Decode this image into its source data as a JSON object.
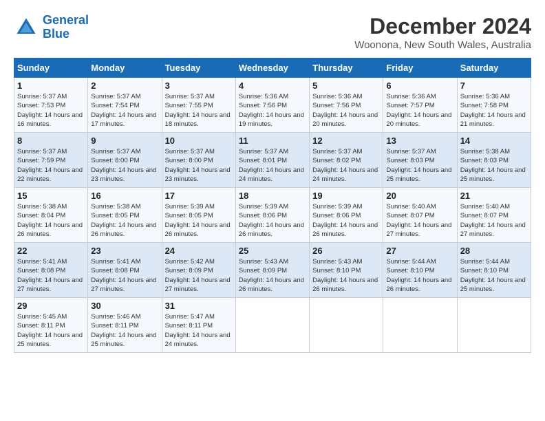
{
  "logo": {
    "line1": "General",
    "line2": "Blue"
  },
  "title": "December 2024",
  "subtitle": "Woonona, New South Wales, Australia",
  "weekdays": [
    "Sunday",
    "Monday",
    "Tuesday",
    "Wednesday",
    "Thursday",
    "Friday",
    "Saturday"
  ],
  "weeks": [
    [
      {
        "day": "1",
        "sunrise": "5:37 AM",
        "sunset": "7:53 PM",
        "daylight": "14 hours and 16 minutes."
      },
      {
        "day": "2",
        "sunrise": "5:37 AM",
        "sunset": "7:54 PM",
        "daylight": "14 hours and 17 minutes."
      },
      {
        "day": "3",
        "sunrise": "5:37 AM",
        "sunset": "7:55 PM",
        "daylight": "14 hours and 18 minutes."
      },
      {
        "day": "4",
        "sunrise": "5:36 AM",
        "sunset": "7:56 PM",
        "daylight": "14 hours and 19 minutes."
      },
      {
        "day": "5",
        "sunrise": "5:36 AM",
        "sunset": "7:56 PM",
        "daylight": "14 hours and 20 minutes."
      },
      {
        "day": "6",
        "sunrise": "5:36 AM",
        "sunset": "7:57 PM",
        "daylight": "14 hours and 20 minutes."
      },
      {
        "day": "7",
        "sunrise": "5:36 AM",
        "sunset": "7:58 PM",
        "daylight": "14 hours and 21 minutes."
      }
    ],
    [
      {
        "day": "8",
        "sunrise": "5:37 AM",
        "sunset": "7:59 PM",
        "daylight": "14 hours and 22 minutes."
      },
      {
        "day": "9",
        "sunrise": "5:37 AM",
        "sunset": "8:00 PM",
        "daylight": "14 hours and 23 minutes."
      },
      {
        "day": "10",
        "sunrise": "5:37 AM",
        "sunset": "8:00 PM",
        "daylight": "14 hours and 23 minutes."
      },
      {
        "day": "11",
        "sunrise": "5:37 AM",
        "sunset": "8:01 PM",
        "daylight": "14 hours and 24 minutes."
      },
      {
        "day": "12",
        "sunrise": "5:37 AM",
        "sunset": "8:02 PM",
        "daylight": "14 hours and 24 minutes."
      },
      {
        "day": "13",
        "sunrise": "5:37 AM",
        "sunset": "8:03 PM",
        "daylight": "14 hours and 25 minutes."
      },
      {
        "day": "14",
        "sunrise": "5:38 AM",
        "sunset": "8:03 PM",
        "daylight": "14 hours and 25 minutes."
      }
    ],
    [
      {
        "day": "15",
        "sunrise": "5:38 AM",
        "sunset": "8:04 PM",
        "daylight": "14 hours and 26 minutes."
      },
      {
        "day": "16",
        "sunrise": "5:38 AM",
        "sunset": "8:05 PM",
        "daylight": "14 hours and 26 minutes."
      },
      {
        "day": "17",
        "sunrise": "5:39 AM",
        "sunset": "8:05 PM",
        "daylight": "14 hours and 26 minutes."
      },
      {
        "day": "18",
        "sunrise": "5:39 AM",
        "sunset": "8:06 PM",
        "daylight": "14 hours and 26 minutes."
      },
      {
        "day": "19",
        "sunrise": "5:39 AM",
        "sunset": "8:06 PM",
        "daylight": "14 hours and 26 minutes."
      },
      {
        "day": "20",
        "sunrise": "5:40 AM",
        "sunset": "8:07 PM",
        "daylight": "14 hours and 27 minutes."
      },
      {
        "day": "21",
        "sunrise": "5:40 AM",
        "sunset": "8:07 PM",
        "daylight": "14 hours and 27 minutes."
      }
    ],
    [
      {
        "day": "22",
        "sunrise": "5:41 AM",
        "sunset": "8:08 PM",
        "daylight": "14 hours and 27 minutes."
      },
      {
        "day": "23",
        "sunrise": "5:41 AM",
        "sunset": "8:08 PM",
        "daylight": "14 hours and 27 minutes."
      },
      {
        "day": "24",
        "sunrise": "5:42 AM",
        "sunset": "8:09 PM",
        "daylight": "14 hours and 27 minutes."
      },
      {
        "day": "25",
        "sunrise": "5:43 AM",
        "sunset": "8:09 PM",
        "daylight": "14 hours and 26 minutes."
      },
      {
        "day": "26",
        "sunrise": "5:43 AM",
        "sunset": "8:10 PM",
        "daylight": "14 hours and 26 minutes."
      },
      {
        "day": "27",
        "sunrise": "5:44 AM",
        "sunset": "8:10 PM",
        "daylight": "14 hours and 26 minutes."
      },
      {
        "day": "28",
        "sunrise": "5:44 AM",
        "sunset": "8:10 PM",
        "daylight": "14 hours and 25 minutes."
      }
    ],
    [
      {
        "day": "29",
        "sunrise": "5:45 AM",
        "sunset": "8:11 PM",
        "daylight": "14 hours and 25 minutes."
      },
      {
        "day": "30",
        "sunrise": "5:46 AM",
        "sunset": "8:11 PM",
        "daylight": "14 hours and 25 minutes."
      },
      {
        "day": "31",
        "sunrise": "5:47 AM",
        "sunset": "8:11 PM",
        "daylight": "14 hours and 24 minutes."
      },
      null,
      null,
      null,
      null
    ]
  ]
}
